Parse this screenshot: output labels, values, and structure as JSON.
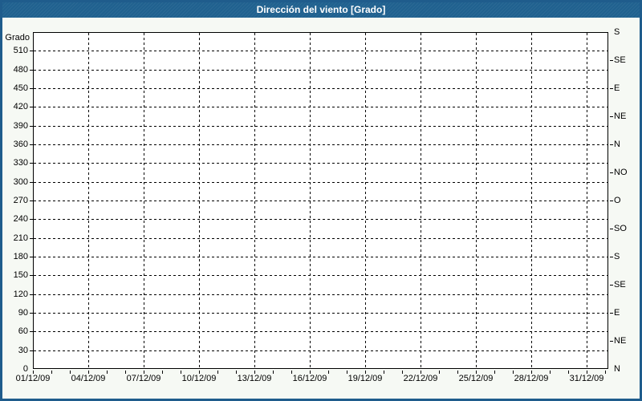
{
  "window": {
    "title": "Dirección del viento [Grado]"
  },
  "colors": {
    "titlebar_bg": "#20618f",
    "titlebar_text": "#ffffff",
    "frame_border": "#1f5c8c",
    "page_bg": "#f6f9f4",
    "plot_bg": "#ffffff",
    "axis_color": "#000000",
    "grid_color": "#000000",
    "label_color": "#000000"
  },
  "chart_data": {
    "type": "line",
    "title": "Dirección del viento [Grado]",
    "grid": true,
    "series": [],
    "y_axis_left": {
      "label": "Grado",
      "min": 0,
      "max": 540,
      "tick_step": 30,
      "ticks": [
        0,
        30,
        60,
        90,
        120,
        150,
        180,
        210,
        240,
        270,
        300,
        330,
        360,
        390,
        420,
        450,
        480,
        510
      ]
    },
    "y_axis_right": {
      "ticks": [
        {
          "value": 0,
          "label": "N"
        },
        {
          "value": 45,
          "label": "NE"
        },
        {
          "value": 90,
          "label": "E"
        },
        {
          "value": 135,
          "label": "SE"
        },
        {
          "value": 180,
          "label": "S"
        },
        {
          "value": 225,
          "label": "SO"
        },
        {
          "value": 270,
          "label": "O"
        },
        {
          "value": 315,
          "label": "NO"
        },
        {
          "value": 360,
          "label": "N"
        },
        {
          "value": 405,
          "label": "NE"
        },
        {
          "value": 450,
          "label": "E"
        },
        {
          "value": 495,
          "label": "SE"
        },
        {
          "value": 540,
          "label": "S"
        }
      ]
    },
    "x_axis": {
      "min_day": 0,
      "max_day": 31.2,
      "minor_tick_every_days": 1,
      "major_ticks": [
        {
          "day": 0,
          "label": "01/12/09"
        },
        {
          "day": 3,
          "label": "04/12/09"
        },
        {
          "day": 6,
          "label": "07/12/09"
        },
        {
          "day": 9,
          "label": "10/12/09"
        },
        {
          "day": 12,
          "label": "13/12/09"
        },
        {
          "day": 15,
          "label": "16/12/09"
        },
        {
          "day": 18,
          "label": "19/12/09"
        },
        {
          "day": 21,
          "label": "22/12/09"
        },
        {
          "day": 24,
          "label": "25/12/09"
        },
        {
          "day": 27,
          "label": "28/12/09"
        },
        {
          "day": 30,
          "label": "31/12/09"
        }
      ]
    }
  }
}
